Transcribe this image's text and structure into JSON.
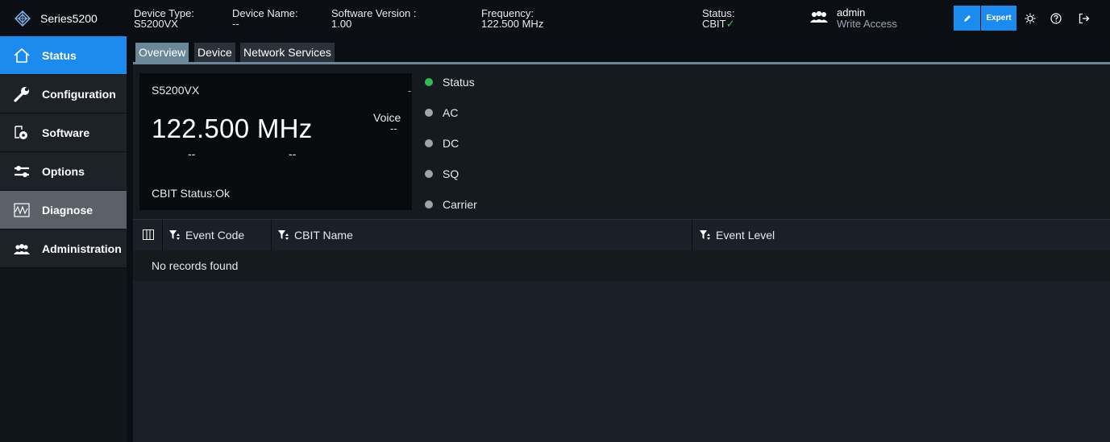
{
  "app": {
    "name": "Series5200",
    "logo_icon": "rs-diamond-icon"
  },
  "header": {
    "device_type_label": "Device Type:",
    "device_type_value": "S5200VX",
    "device_name_label": "Device Name:",
    "device_name_value": "--",
    "software_version_label": "Software Version :",
    "software_version_value": "1.00",
    "frequency_label": "Frequency:",
    "frequency_value": "122.500 MHz",
    "status_label": "Status:",
    "status_value": "CBIT",
    "status_check": "✓",
    "user_name": "admin",
    "user_role": "Write Access",
    "expert_label": "Expert"
  },
  "sidebar": {
    "items": [
      {
        "label": "Status",
        "icon": "home-icon"
      },
      {
        "label": "Configuration",
        "icon": "wrench-icon"
      },
      {
        "label": "Software",
        "icon": "software-icon"
      },
      {
        "label": "Options",
        "icon": "options-icon"
      },
      {
        "label": "Diagnose",
        "icon": "diagnose-icon"
      },
      {
        "label": "Administration",
        "icon": "users-icon"
      }
    ]
  },
  "tabs": [
    "Overview",
    "Device",
    "Network Services"
  ],
  "freq_card": {
    "device_type": "S5200VX",
    "top_right": "-",
    "voice_label": "Voice",
    "voice_value": "--",
    "frequency": "122.500 MHz",
    "sub_left": "--",
    "sub_right": "--",
    "cbit_status": "CBIT Status:Ok"
  },
  "indicators": [
    {
      "label": "Status",
      "state": "green"
    },
    {
      "label": "AC",
      "state": "gray"
    },
    {
      "label": "DC",
      "state": "gray"
    },
    {
      "label": "SQ",
      "state": "gray"
    },
    {
      "label": "Carrier",
      "state": "gray"
    }
  ],
  "table": {
    "columns": [
      "Event Code",
      "CBIT Name",
      "Event Level"
    ],
    "empty_message": "No records found"
  },
  "colors": {
    "accent": "#1b8bef",
    "ok": "#2fbd51",
    "inactive": "#9ea6ad"
  }
}
